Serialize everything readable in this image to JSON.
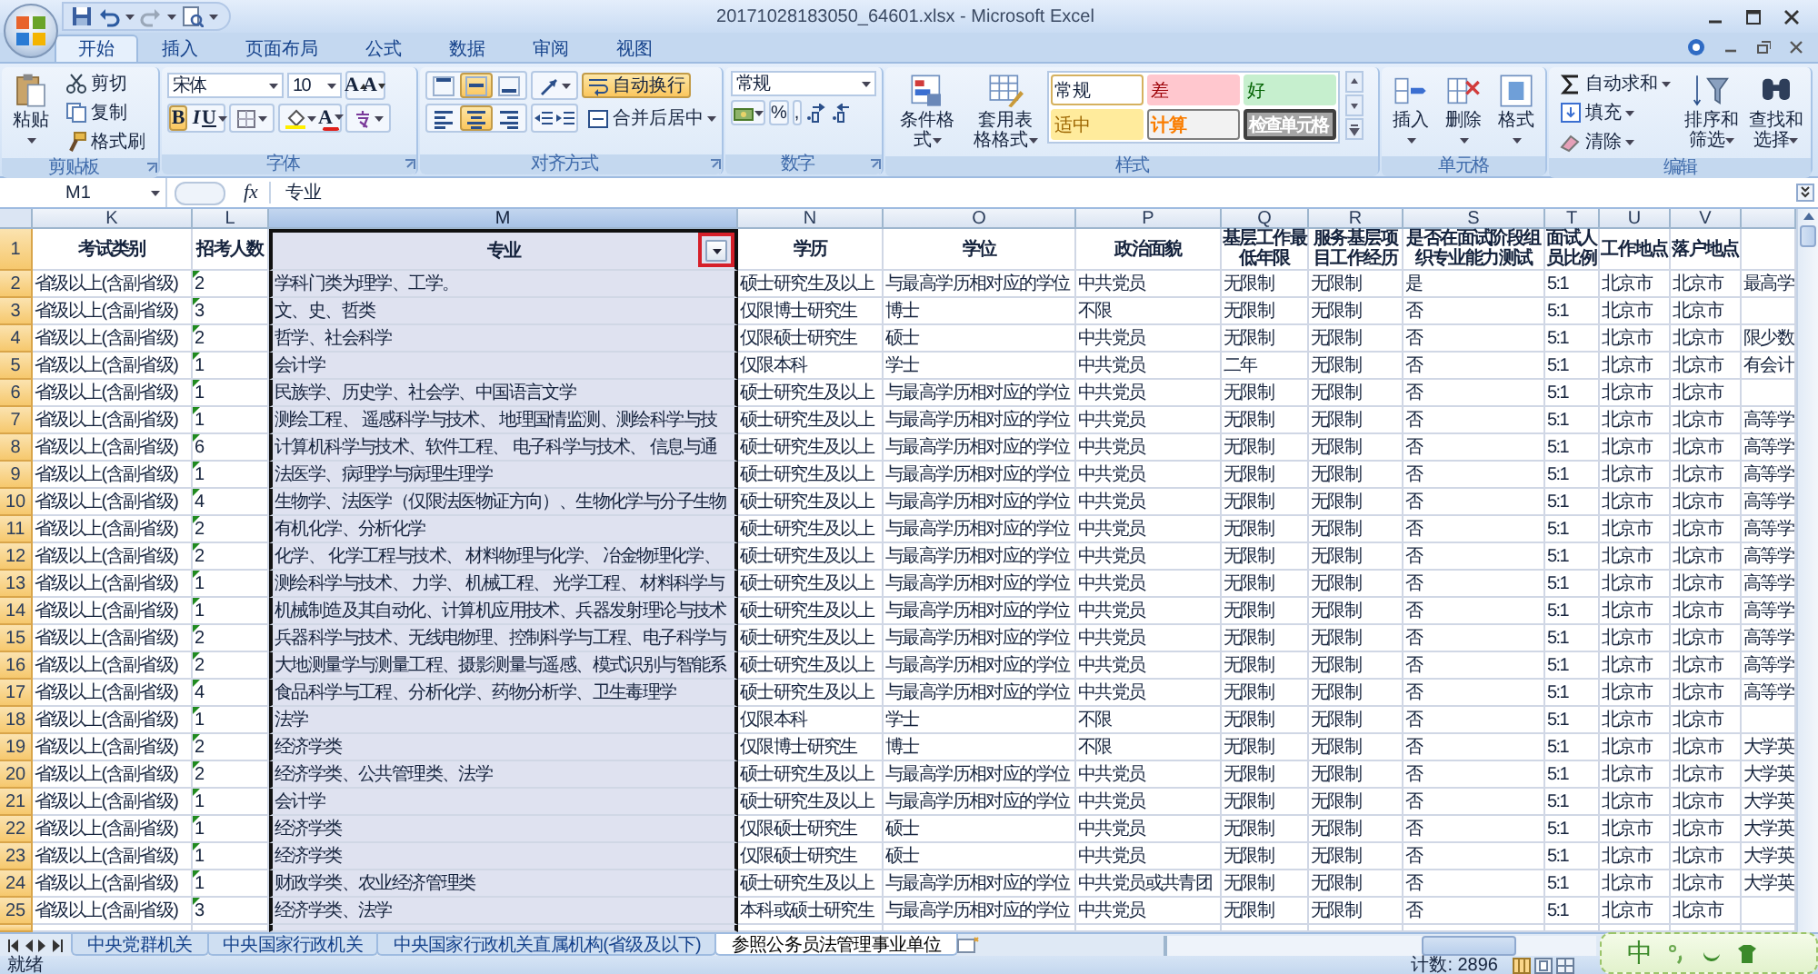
{
  "window": {
    "title": "20171028183050_64601.xlsx - Microsoft Excel"
  },
  "ribbon_tabs": [
    {
      "label": "开始",
      "selected": true
    },
    {
      "label": "插入",
      "selected": false
    },
    {
      "label": "页面布局",
      "selected": false
    },
    {
      "label": "公式",
      "selected": false
    },
    {
      "label": "数据",
      "selected": false
    },
    {
      "label": "审阅",
      "selected": false
    },
    {
      "label": "视图",
      "selected": false
    }
  ],
  "clipboard": {
    "label": "剪贴板",
    "paste": "粘贴",
    "cut": "剪切",
    "copy": "复制",
    "format_painter": "格式刷"
  },
  "font": {
    "label": "字体",
    "name": "宋体",
    "size": "10",
    "grow": "A",
    "shrink": "A",
    "bold": "B",
    "bold_on": true,
    "italic": "I",
    "underline": "U",
    "font_color": "A"
  },
  "alignment": {
    "label": "对齐方式",
    "middle_align_on": true,
    "center_align_on": true,
    "wrap": "自动换行",
    "wrap_on": true,
    "merge": "合并后居中"
  },
  "number": {
    "label": "数字",
    "format": "常规",
    "percent": "%",
    "comma": ","
  },
  "styles": {
    "label": "样式",
    "conditional": "条件格式",
    "table": "套用表格格式",
    "cell_styles": [
      {
        "label": "常规",
        "kind": "normal"
      },
      {
        "label": "差",
        "kind": "bad"
      },
      {
        "label": "好",
        "kind": "good"
      },
      {
        "label": "适中",
        "kind": "neutral"
      },
      {
        "label": "计算",
        "kind": "calculation"
      },
      {
        "label": "检查单元格",
        "kind": "check"
      }
    ]
  },
  "cells": {
    "label": "单元格",
    "insert": "插入",
    "delete": "删除",
    "format": "格式"
  },
  "editing": {
    "label": "编辑",
    "autosum": "自动求和",
    "fill": "填充",
    "clear": "清除",
    "sort": "排序和筛选",
    "find": "查找和选择"
  },
  "formula_bar": {
    "name_box": "M1",
    "function_label": "fx",
    "content": "专业"
  },
  "sheet": {
    "autofilter": true,
    "annotation_box": true,
    "columns": [
      {
        "letter": "K",
        "selected": false
      },
      {
        "letter": "L",
        "selected": false
      },
      {
        "letter": "M",
        "selected": true
      },
      {
        "letter": "N",
        "selected": false
      },
      {
        "letter": "O",
        "selected": false
      },
      {
        "letter": "P",
        "selected": false
      },
      {
        "letter": "Q",
        "selected": false
      },
      {
        "letter": "R",
        "selected": false
      },
      {
        "letter": "S",
        "selected": false
      },
      {
        "letter": "T",
        "selected": false
      },
      {
        "letter": "U",
        "selected": false
      },
      {
        "letter": "V",
        "selected": false
      },
      {
        "selected": false
      }
    ],
    "header_row": {
      "number": "1",
      "cells": [
        "考试类别",
        "招考人数",
        "专业",
        "学历",
        "学位",
        "政治面貌",
        "基层工作最低年限",
        "服务基层项目工作经历",
        "是否在面试阶段组织专业能力测试",
        "面试人员比例",
        "工作地点",
        "落户地点",
        null
      ]
    },
    "rows": [
      {
        "number": "2",
        "flagged": true,
        "cells": [
          "省级以上(含副省级)",
          "2",
          "学科门类为理学、工学。",
          "硕士研究生及以上",
          "与最高学历相对应的学位",
          "中共党员",
          "无限制",
          "无限制",
          "是",
          "5:1",
          "北京市",
          "北京市",
          "最高学"
        ]
      },
      {
        "number": "3",
        "flagged": true,
        "cells": [
          "省级以上(含副省级)",
          "3",
          "文、史、哲类",
          "仅限博士研究生",
          "博士",
          "不限",
          "无限制",
          "无限制",
          "否",
          "5:1",
          "北京市",
          "北京市",
          null
        ]
      },
      {
        "number": "4",
        "flagged": true,
        "cells": [
          "省级以上(含副省级)",
          "2",
          "哲学、社会科学",
          "仅限硕士研究生",
          "硕士",
          "中共党员",
          "无限制",
          "无限制",
          "否",
          "5:1",
          "北京市",
          "北京市",
          "限少数"
        ]
      },
      {
        "number": "5",
        "flagged": true,
        "cells": [
          "省级以上(含副省级)",
          "1",
          "会计学",
          "仅限本科",
          "学士",
          "中共党员",
          "二年",
          "无限制",
          "否",
          "5:1",
          "北京市",
          "北京市",
          "有会计"
        ]
      },
      {
        "number": "6",
        "flagged": true,
        "cells": [
          "省级以上(含副省级)",
          "1",
          "民族学、历史学、社会学、中国语言文学",
          "硕士研究生及以上",
          "与最高学历相对应的学位",
          "中共党员",
          "无限制",
          "无限制",
          "否",
          "5:1",
          "北京市",
          "北京市",
          null
        ]
      },
      {
        "number": "7",
        "flagged": true,
        "cells": [
          "省级以上(含副省级)",
          "1",
          "测绘工程、 遥感科学与技术、 地理国情监测、测绘科学与技",
          "硕士研究生及以上",
          "与最高学历相对应的学位",
          "中共党员",
          "无限制",
          "无限制",
          "否",
          "5:1",
          "北京市",
          "北京市",
          "高等学"
        ]
      },
      {
        "number": "8",
        "flagged": true,
        "cells": [
          "省级以上(含副省级)",
          "6",
          "计算机科学与技术、软件工程、 电子科学与技术、 信息与通",
          "硕士研究生及以上",
          "与最高学历相对应的学位",
          "中共党员",
          "无限制",
          "无限制",
          "否",
          "5:1",
          "北京市",
          "北京市",
          "高等学"
        ]
      },
      {
        "number": "9",
        "flagged": true,
        "cells": [
          "省级以上(含副省级)",
          "1",
          "法医学、病理学与病理生理学",
          "硕士研究生及以上",
          "与最高学历相对应的学位",
          "中共党员",
          "无限制",
          "无限制",
          "否",
          "5:1",
          "北京市",
          "北京市",
          "高等学"
        ]
      },
      {
        "number": "10",
        "flagged": true,
        "cells": [
          "省级以上(含副省级)",
          "4",
          "生物学、法医学（仅限法医物证方向）、生物化学与分子生物",
          "硕士研究生及以上",
          "与最高学历相对应的学位",
          "中共党员",
          "无限制",
          "无限制",
          "否",
          "5:1",
          "北京市",
          "北京市",
          "高等学"
        ]
      },
      {
        "number": "11",
        "flagged": true,
        "cells": [
          "省级以上(含副省级)",
          "2",
          "有机化学、分析化学",
          "硕士研究生及以上",
          "与最高学历相对应的学位",
          "中共党员",
          "无限制",
          "无限制",
          "否",
          "5:1",
          "北京市",
          "北京市",
          "高等学"
        ]
      },
      {
        "number": "12",
        "flagged": true,
        "cells": [
          "省级以上(含副省级)",
          "2",
          "化学、 化学工程与技术、 材料物理与化学、 冶金物理化学、",
          "硕士研究生及以上",
          "与最高学历相对应的学位",
          "中共党员",
          "无限制",
          "无限制",
          "否",
          "5:1",
          "北京市",
          "北京市",
          "高等学"
        ]
      },
      {
        "number": "13",
        "flagged": true,
        "cells": [
          "省级以上(含副省级)",
          "1",
          "测绘科学与技术、 力学、 机械工程、 光学工程、 材料科学与",
          "硕士研究生及以上",
          "与最高学历相对应的学位",
          "中共党员",
          "无限制",
          "无限制",
          "否",
          "5:1",
          "北京市",
          "北京市",
          "高等学"
        ]
      },
      {
        "number": "14",
        "flagged": true,
        "cells": [
          "省级以上(含副省级)",
          "1",
          "机械制造及其自动化、计算机应用技术、兵器发射理论与技术",
          "硕士研究生及以上",
          "与最高学历相对应的学位",
          "中共党员",
          "无限制",
          "无限制",
          "否",
          "5:1",
          "北京市",
          "北京市",
          "高等学"
        ]
      },
      {
        "number": "15",
        "flagged": true,
        "cells": [
          "省级以上(含副省级)",
          "2",
          "兵器科学与技术、无线电物理、控制科学与工程、电子科学与",
          "硕士研究生及以上",
          "与最高学历相对应的学位",
          "中共党员",
          "无限制",
          "无限制",
          "否",
          "5:1",
          "北京市",
          "北京市",
          "高等学"
        ]
      },
      {
        "number": "16",
        "flagged": true,
        "cells": [
          "省级以上(含副省级)",
          "2",
          "大地测量学与测量工程、摄影测量与遥感、模式识别与智能系",
          "硕士研究生及以上",
          "与最高学历相对应的学位",
          "中共党员",
          "无限制",
          "无限制",
          "否",
          "5:1",
          "北京市",
          "北京市",
          "高等学"
        ]
      },
      {
        "number": "17",
        "flagged": true,
        "cells": [
          "省级以上(含副省级)",
          "4",
          "食品科学与工程、分析化学、药物分析学、卫生毒理学",
          "硕士研究生及以上",
          "与最高学历相对应的学位",
          "中共党员",
          "无限制",
          "无限制",
          "否",
          "5:1",
          "北京市",
          "北京市",
          "高等学"
        ]
      },
      {
        "number": "18",
        "flagged": true,
        "cells": [
          "省级以上(含副省级)",
          "1",
          "法学",
          "仅限本科",
          "学士",
          "不限",
          "无限制",
          "无限制",
          "否",
          "5:1",
          "北京市",
          "北京市",
          null
        ]
      },
      {
        "number": "19",
        "flagged": true,
        "cells": [
          "省级以上(含副省级)",
          "2",
          "经济学类",
          "仅限博士研究生",
          "博士",
          "不限",
          "无限制",
          "无限制",
          "否",
          "5:1",
          "北京市",
          "北京市",
          "大学英"
        ]
      },
      {
        "number": "20",
        "flagged": true,
        "cells": [
          "省级以上(含副省级)",
          "2",
          "经济学类、公共管理类、法学",
          "硕士研究生及以上",
          "与最高学历相对应的学位",
          "中共党员",
          "无限制",
          "无限制",
          "否",
          "5:1",
          "北京市",
          "北京市",
          "大学英"
        ]
      },
      {
        "number": "21",
        "flagged": true,
        "cells": [
          "省级以上(含副省级)",
          "1",
          "会计学",
          "硕士研究生及以上",
          "与最高学历相对应的学位",
          "中共党员",
          "无限制",
          "无限制",
          "否",
          "5:1",
          "北京市",
          "北京市",
          "大学英"
        ]
      },
      {
        "number": "22",
        "flagged": true,
        "cells": [
          "省级以上(含副省级)",
          "1",
          "经济学类",
          "仅限硕士研究生",
          "硕士",
          "中共党员",
          "无限制",
          "无限制",
          "否",
          "5:1",
          "北京市",
          "北京市",
          "大学英"
        ]
      },
      {
        "number": "23",
        "flagged": true,
        "cells": [
          "省级以上(含副省级)",
          "1",
          "经济学类",
          "仅限硕士研究生",
          "硕士",
          "中共党员",
          "无限制",
          "无限制",
          "否",
          "5:1",
          "北京市",
          "北京市",
          "大学英"
        ]
      },
      {
        "number": "24",
        "flagged": true,
        "cells": [
          "省级以上(含副省级)",
          "1",
          "财政学类、农业经济管理类",
          "硕士研究生及以上",
          "与最高学历相对应的学位",
          "中共党员或共青团",
          "无限制",
          "无限制",
          "否",
          "5:1",
          "北京市",
          "北京市",
          "大学英"
        ]
      },
      {
        "number": "25",
        "flagged": true,
        "cells": [
          "省级以上(含副省级)",
          "3",
          "经济学类、法学",
          "本科或硕士研究生",
          "与最高学历相对应的学位",
          "中共党员",
          "无限制",
          "无限制",
          "否",
          "5:1",
          "北京市",
          "北京市",
          null
        ]
      }
    ]
  },
  "sheet_tabs": [
    {
      "label": "中央党群机关",
      "selected": false
    },
    {
      "label": "中央国家行政机关",
      "selected": false
    },
    {
      "label": "中央国家行政机关直属机构(省级及以下)",
      "selected": false
    },
    {
      "label": "参照公务员法管理事业单位",
      "selected": true
    }
  ],
  "status_bar": {
    "ready": "就绪",
    "count": "计数: 2896"
  },
  "ime": {
    "mode": "中"
  }
}
